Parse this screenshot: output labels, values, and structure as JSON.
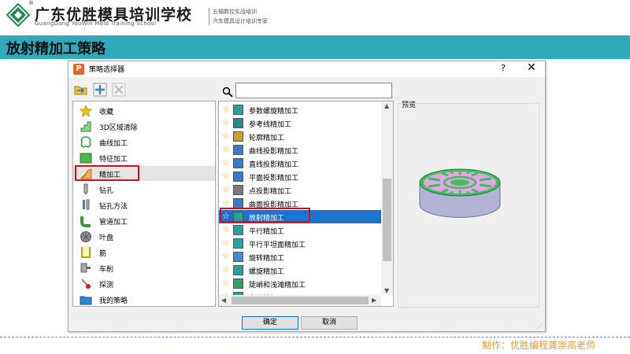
{
  "header": {
    "school_name": "广东优胜模具培训学校",
    "reg_mark": "®",
    "school_name_en": "GuangDong YouWin Mold Training School",
    "slogan_line1": "五轴数控实战培训",
    "slogan_line2": "汽车模具设计培训专家"
  },
  "page_title": "放射精加工策略",
  "footer": "制作：优胜编程龚崇高老师",
  "dialog": {
    "icon_letter": "P",
    "title": "策略选择器",
    "help": "?",
    "close": "✕",
    "search_value": "",
    "left_items": [
      {
        "label": "收藏",
        "icon": "star-icon"
      },
      {
        "label": "3D区域清除",
        "icon": "area-clearance-icon"
      },
      {
        "label": "曲线加工",
        "icon": "curve-machining-icon"
      },
      {
        "label": "特征加工",
        "icon": "feature-machining-icon"
      },
      {
        "label": "精加工",
        "icon": "finishing-icon"
      },
      {
        "label": "钻孔",
        "icon": "drilling-icon"
      },
      {
        "label": "钻孔方法",
        "icon": "drilling-method-icon"
      },
      {
        "label": "管道加工",
        "icon": "port-machining-icon"
      },
      {
        "label": "叶盘",
        "icon": "blisk-icon"
      },
      {
        "label": "筋",
        "icon": "rib-icon"
      },
      {
        "label": "车削",
        "icon": "turning-icon"
      },
      {
        "label": "探测",
        "icon": "probing-icon"
      },
      {
        "label": "我的策略",
        "icon": "folder-icon"
      }
    ],
    "mid_items": [
      {
        "label": "参数螺旋精加工"
      },
      {
        "label": "参考线精加工"
      },
      {
        "label": "轮廓精加工"
      },
      {
        "label": "曲线投影精加工"
      },
      {
        "label": "直线投影精加工"
      },
      {
        "label": "平面投影精加工"
      },
      {
        "label": "点投影精加工"
      },
      {
        "label": "曲面投影精加工"
      },
      {
        "label": "放射精加工"
      },
      {
        "label": "平行精加工"
      },
      {
        "label": "平行平坦面精加工"
      },
      {
        "label": "旋转精加工"
      },
      {
        "label": "螺旋精加工"
      },
      {
        "label": "陡峭和浅滩精加工"
      },
      {
        "label": "曲面精加工"
      }
    ],
    "preview_label": "预览",
    "ok_label": "确定",
    "cancel_label": "取消"
  },
  "colors": {
    "title_bar": "#2faabd",
    "selection": "#1a74d0",
    "highlight_box": "#d0101a",
    "footer_text": "#e59a3a",
    "preview_top": "#e6a3e6",
    "preview_ribs": "#3fbf5f",
    "preview_side": "#b3b3d6"
  }
}
